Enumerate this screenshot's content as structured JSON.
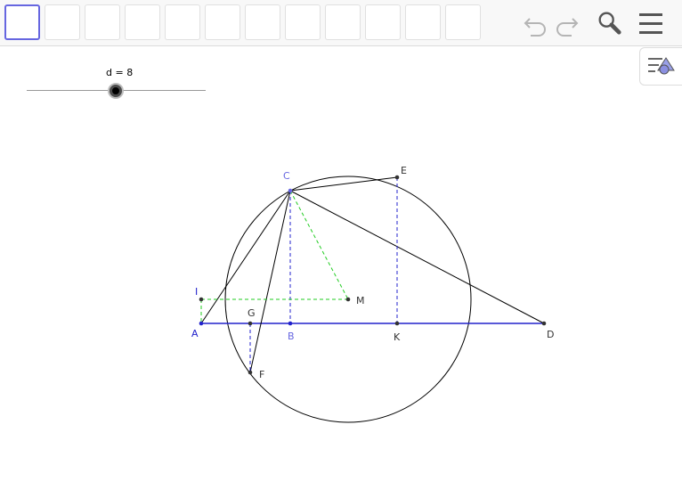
{
  "toolbar": {
    "tool_count": 12,
    "selected_tool_index": 0,
    "icons": [
      "undo-icon",
      "redo-icon",
      "search-icon",
      "menu-icon"
    ]
  },
  "side_panel": {
    "icon": "algebra-view-icon"
  },
  "slider": {
    "label": "d = 8",
    "value": 8
  },
  "points": {
    "A": "A",
    "B": "B",
    "C": "C",
    "D": "D",
    "E": "E",
    "F": "F",
    "G": "G",
    "I": "I",
    "K": "K",
    "M": "M"
  },
  "colors": {
    "accent": "#6666e0",
    "construction_blue": "#2222cc",
    "dashed_green": "#22cc22",
    "line": "#000000",
    "label_blue": "#6666e0"
  }
}
